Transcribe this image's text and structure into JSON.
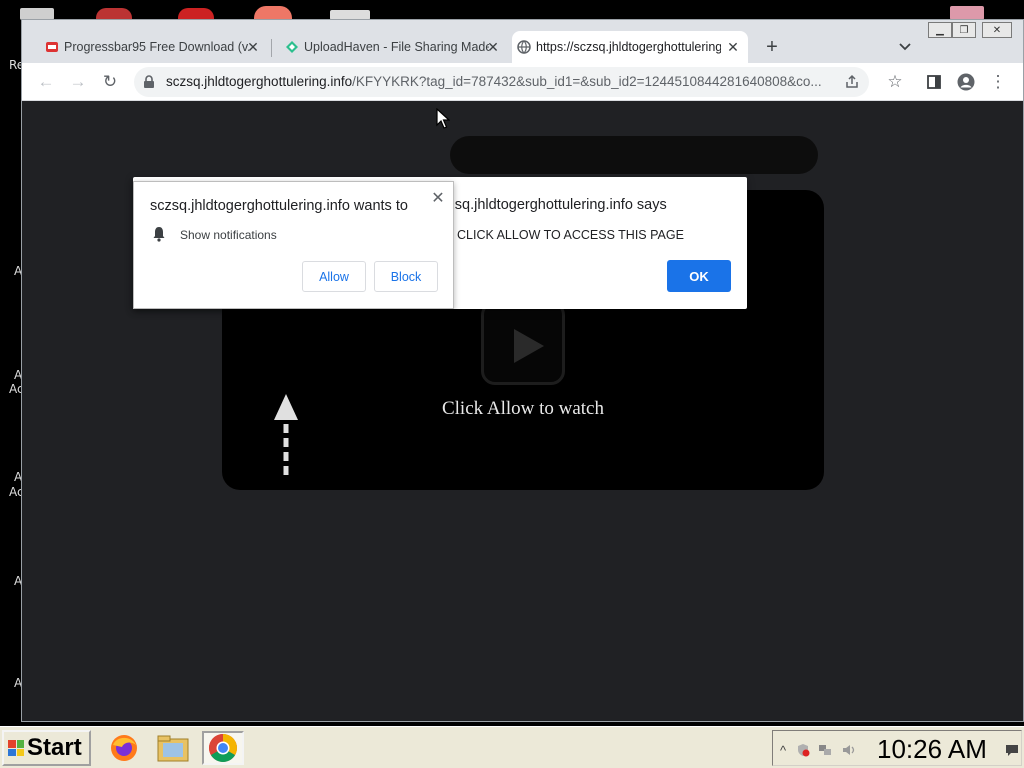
{
  "browser": {
    "tabs": [
      {
        "label": "Progressbar95 Free Download (v...",
        "favicon": "progressbar-favicon",
        "active": false
      },
      {
        "label": "UploadHaven - File Sharing Made...",
        "favicon": "uploadhaven-favicon",
        "active": false
      },
      {
        "label": "https://sczsq.jhldtogerghottulering...",
        "favicon": "globe-icon",
        "active": true
      }
    ],
    "new_tab_symbol": "+",
    "tab_menu_symbol": "⌄",
    "address": {
      "host": "sczsq.jhldtogerghottulering.info",
      "path": "/KFYYKRK?tag_id=787432&sub_id1=&sub_id2=1244510844281640808&co..."
    }
  },
  "alert_dialog": {
    "title": "sczsq.jhldtogerghottulering.info says",
    "message": "CLICK ALLOW TO ACCESS THIS PAGE",
    "ok_label": "OK"
  },
  "permission_prompt": {
    "title": "sczsq.jhldtogerghottulering.info wants to",
    "permission": "Show notifications",
    "allow_label": "Allow",
    "block_label": "Block",
    "close_symbol": "✕"
  },
  "page": {
    "watch_text": "Click Allow to watch"
  },
  "taskbar": {
    "start_label": "Start",
    "clock": "10:26 AM",
    "tray_expand_symbol": "^"
  },
  "desktop": {
    "labels": [
      "Re",
      "A",
      "A",
      "Ac",
      "A",
      "Ac",
      "A",
      "A"
    ]
  },
  "colors": {
    "accent": "#1a73e8",
    "page_bg": "#202124",
    "tab_strip": "#dee1e6",
    "taskbar": "#ece9d8"
  }
}
